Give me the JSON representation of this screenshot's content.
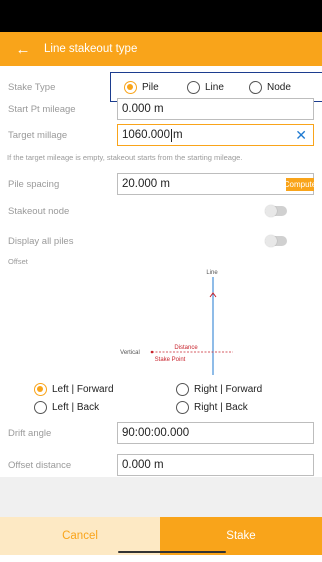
{
  "header": {
    "title": "Line stakeout type",
    "back_icon": "arrow-left-icon"
  },
  "stake_type": {
    "label": "Stake Type",
    "options": [
      "Pile",
      "Line",
      "Node"
    ],
    "selected": "Pile"
  },
  "start_pt_mileage": {
    "label": "Start Pt mileage",
    "value": "0.000 m"
  },
  "target_mileage": {
    "label": "Target millage",
    "value_number": "1060.000",
    "value_unit": "m",
    "hint": "If the target mileage is empty, stakeout starts from the starting mileage."
  },
  "pile_spacing": {
    "label": "Pile spacing",
    "value": "20.000 m",
    "compute_label": "Compute"
  },
  "stakeout_node": {
    "label": "Stakeout node",
    "on": false
  },
  "display_all_piles": {
    "label": "Display all piles",
    "on": false
  },
  "offset": {
    "label": "Offset",
    "diagram": {
      "line_label": "Line",
      "distance_label": "Distance",
      "vertical_label": "Vertical",
      "stake_point_label": "Stake Point"
    },
    "directions": [
      {
        "label": "Left | Forward",
        "selected": true
      },
      {
        "label": "Right | Forward",
        "selected": false
      },
      {
        "label": "Left | Back",
        "selected": false
      },
      {
        "label": "Right | Back",
        "selected": false
      }
    ]
  },
  "drift_angle": {
    "label": "Drift angle",
    "value": "90:00:00.000"
  },
  "offset_distance": {
    "label": "Offset distance",
    "value": "0.000 m"
  },
  "actions": {
    "cancel_label": "Cancel",
    "stake_label": "Stake"
  },
  "colors": {
    "accent": "#f9a41a",
    "highlight_border": "#1c3d8f",
    "diagram_line": "#1f7ad1",
    "diagram_red": "#c8232c"
  }
}
